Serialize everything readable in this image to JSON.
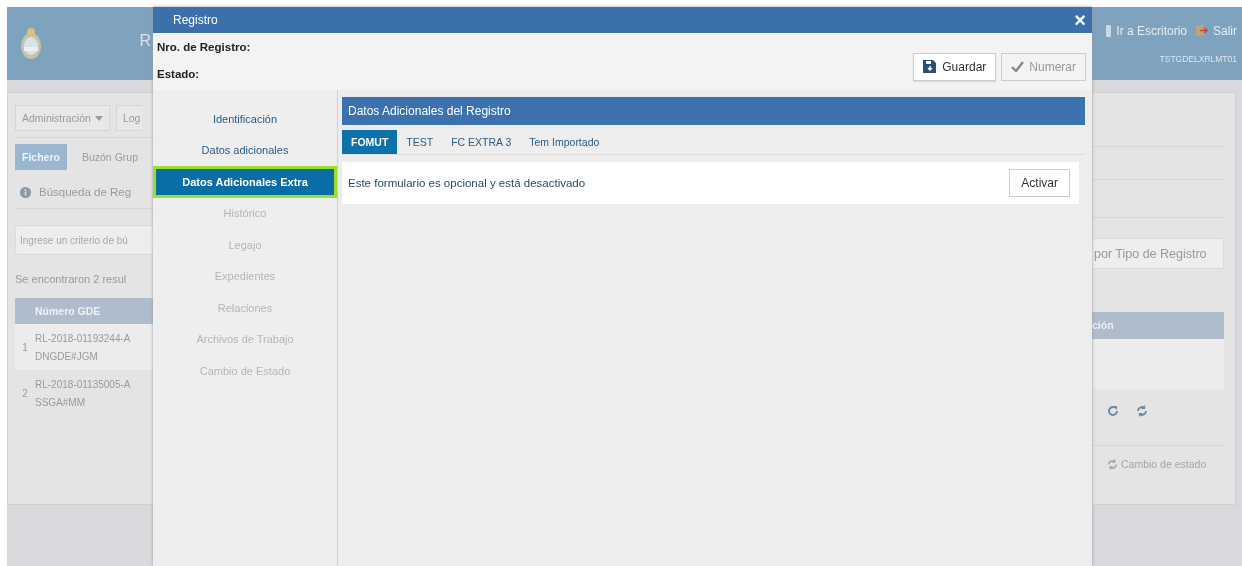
{
  "background_left": {
    "title": "R",
    "menu_button": "Administración",
    "menu_next": "Log",
    "tabs": [
      {
        "label": "Fichero",
        "selected": true
      },
      {
        "label": "Buzón Grup",
        "selected": false
      }
    ],
    "section": "Búsqueda de Reg",
    "search": {
      "placeholder": "Ingrese un criterio de bú"
    },
    "results": "Se encontraron 2 resul",
    "table": {
      "columns": [
        "Número GDE"
      ],
      "rows": [
        {
          "index": "1",
          "lines": [
            "RL-2018-01193244-A",
            "DNGDE#JGM"
          ]
        },
        {
          "index": "2",
          "lines": [
            "RL-2018-01135005-A",
            "SSGA#MM"
          ]
        }
      ]
    }
  },
  "dialog": {
    "title": "Registro",
    "close": "×",
    "fields": [
      {
        "label": "Nro. de Registro:"
      },
      {
        "label": "Estado:"
      }
    ],
    "buttons": [
      {
        "label": "Guardar",
        "kind": "save",
        "disabled": false
      },
      {
        "label": "Numerar",
        "kind": "check",
        "disabled": true
      }
    ],
    "nav": [
      {
        "label": "Identificación",
        "selected": false,
        "disabled": false
      },
      {
        "label": "Datos adicionales",
        "selected": false,
        "disabled": false
      },
      {
        "label": "Datos Adicionales Extra",
        "selected": true,
        "disabled": false
      },
      {
        "label": "Histórico",
        "selected": false,
        "disabled": true
      },
      {
        "label": "Legajo",
        "selected": false,
        "disabled": true
      },
      {
        "label": "Expedientes",
        "selected": false,
        "disabled": true
      },
      {
        "label": "Relaciones",
        "selected": false,
        "disabled": true
      },
      {
        "label": "Archivos de Trabajo",
        "selected": false,
        "disabled": true
      },
      {
        "label": "Cambio de Estado",
        "selected": false,
        "disabled": true
      }
    ],
    "panel": {
      "title": "Datos Adicionales del Registro",
      "tabs": [
        {
          "label": "FOMUT",
          "selected": true
        },
        {
          "label": "TEST",
          "selected": false
        },
        {
          "label": "FC EXTRA 3",
          "selected": false
        },
        {
          "label": "Tem Importado",
          "selected": false
        }
      ],
      "message": "Este formulario es opcional y está desactivado",
      "action": "Activar"
    }
  },
  "background_right": {
    "links": [
      "Ir a Escritorio",
      "Salir"
    ],
    "user": "TSTGDELXRLMT01",
    "filter_button": "por Tipo de Registro",
    "column": "ción",
    "status_action": "Cambio de estado"
  }
}
